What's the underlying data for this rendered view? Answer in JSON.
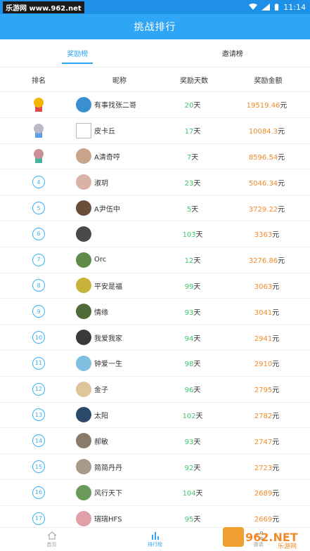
{
  "status_bar": {
    "watermark": "乐游网 www.962.net",
    "time": "11:14"
  },
  "header": {
    "title": "挑战排行"
  },
  "tabs": [
    {
      "label": "奖励榜",
      "active": true
    },
    {
      "label": "邀请榜",
      "active": false
    }
  ],
  "columns": {
    "rank": "排名",
    "name": "昵称",
    "days": "奖励天数",
    "amount": "奖励金额"
  },
  "units": {
    "days": "天",
    "amount": "元"
  },
  "rows": [
    {
      "rank": "1",
      "medal": "gold",
      "name": "有事找张二哥",
      "days": "20",
      "amount": "19519.46",
      "avatar_color": "#3a8fd0"
    },
    {
      "rank": "2",
      "medal": "silver",
      "name": "皮卡丘",
      "days": "17",
      "amount": "10084.3",
      "avatar_color": "broken"
    },
    {
      "rank": "3",
      "medal": "bronze",
      "name": "A清奇哼",
      "days": "7",
      "amount": "8596.54",
      "avatar_color": "#c9a48a"
    },
    {
      "rank": "4",
      "name": "淑玥",
      "days": "23",
      "amount": "5046.34",
      "avatar_color": "#d9b3a6"
    },
    {
      "rank": "5",
      "name": "A尹伍中",
      "days": "5",
      "amount": "3729.22",
      "avatar_color": "#6b4e3a"
    },
    {
      "rank": "6",
      "name": "",
      "days": "103",
      "amount": "3363",
      "avatar_color": "#4a4a4a"
    },
    {
      "rank": "7",
      "name": "Orc",
      "days": "12",
      "amount": "3276.86",
      "avatar_color": "#5f8a4a"
    },
    {
      "rank": "8",
      "name": "平安是福",
      "days": "99",
      "amount": "3063",
      "avatar_color": "#c9b23a"
    },
    {
      "rank": "9",
      "name": "情缘",
      "days": "93",
      "amount": "3041",
      "avatar_color": "#4f6b3a"
    },
    {
      "rank": "10",
      "name": "我爱我家",
      "days": "94",
      "amount": "2941",
      "avatar_color": "#3a3a3a"
    },
    {
      "rank": "11",
      "name": "钟爱一生",
      "days": "98",
      "amount": "2910",
      "avatar_color": "#7fbfe0"
    },
    {
      "rank": "12",
      "name": "金子",
      "days": "96",
      "amount": "2795",
      "avatar_color": "#e0c49a"
    },
    {
      "rank": "13",
      "name": "太阳",
      "days": "102",
      "amount": "2782",
      "avatar_color": "#2b4a6b"
    },
    {
      "rank": "14",
      "name": "郝敏",
      "days": "93",
      "amount": "2747",
      "avatar_color": "#8a7a6a"
    },
    {
      "rank": "15",
      "name": "简简丹丹",
      "days": "92",
      "amount": "2723",
      "avatar_color": "#a89a8a"
    },
    {
      "rank": "16",
      "name": "风行天下",
      "days": "104",
      "amount": "2689",
      "avatar_color": "#6a9a5a"
    },
    {
      "rank": "17",
      "name": "瑞瑞HFS",
      "days": "95",
      "amount": "2669",
      "avatar_color": "#e0a0a8"
    }
  ],
  "bottom_nav": [
    {
      "label": "首页",
      "icon": "home-icon",
      "active": false
    },
    {
      "label": "排行榜",
      "icon": "bar-chart-icon",
      "active": true
    },
    {
      "label": "邀请",
      "icon": "share-icon",
      "active": false
    }
  ],
  "watermark_br": "962.NET 乐游网"
}
